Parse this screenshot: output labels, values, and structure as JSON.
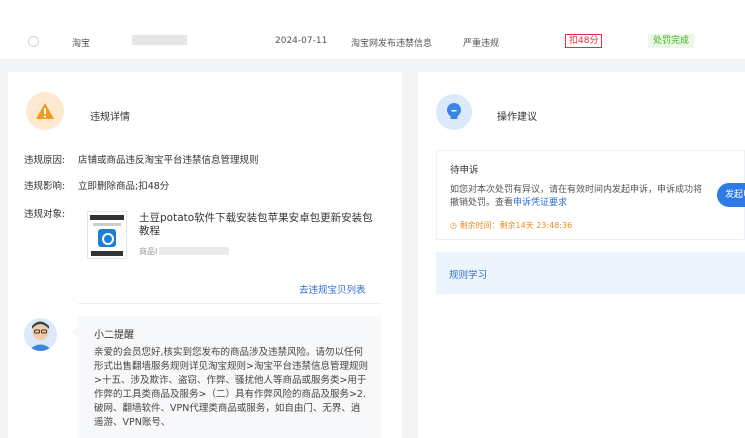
{
  "record": {
    "platform": "淘宝",
    "date": "2024-07-11",
    "type": "淘宝网发布违禁信息",
    "severity": "严重违规",
    "deduction": "扣48分",
    "status": "处罚完成",
    "status_color": "#3fb31f",
    "deduction_color": "#e0303a"
  },
  "violation": {
    "title": "违规详情",
    "icon": "warning-icon",
    "reason_label": "违规原因:",
    "reason_value": "店铺或商品违反淘宝平台违禁信息管理规则",
    "impact_label": "违规影响:",
    "impact_value": "立即删除商品;扣48分",
    "object_label": "违规对象:",
    "product": {
      "title": "土豆potato软件下载安装包苹果安卓包更新安装包教程",
      "id_label": "商品I"
    },
    "list_link": "去违规宝贝列表"
  },
  "reminder": {
    "title": "小二提醒",
    "body": "亲爱的会员您好,核实到您发布的商品涉及违禁风险。请勿以任何形式出售翻墙服务规则详见淘宝规则>淘宝平台违禁信息管理规则>十五、涉及欺诈、盗窃、作弊、骚扰他人等商品或服务类>用于作弊的工具类商品及服务>（二）具有作弊风险的商品及服务>2.破网、翻墙软件、VPN代理类商品或服务，如自由门、无界、逍遥游、VPN账号、"
  },
  "advice": {
    "title": "操作建议",
    "icon": "lightbulb-icon",
    "appeal": {
      "title": "待申诉",
      "desc_before": "如您对本次处罚有异议，请在有效时间内发起申诉，申诉成功将撤销处罚。查看",
      "desc_link": "申诉凭证要求",
      "remaining": "剩余时间：剩余14天 23:48:36",
      "button": "发起申诉"
    },
    "rule_study": "规则学习"
  },
  "colors": {
    "accent": "#2f6fd6",
    "warning": "#f08a1c"
  }
}
